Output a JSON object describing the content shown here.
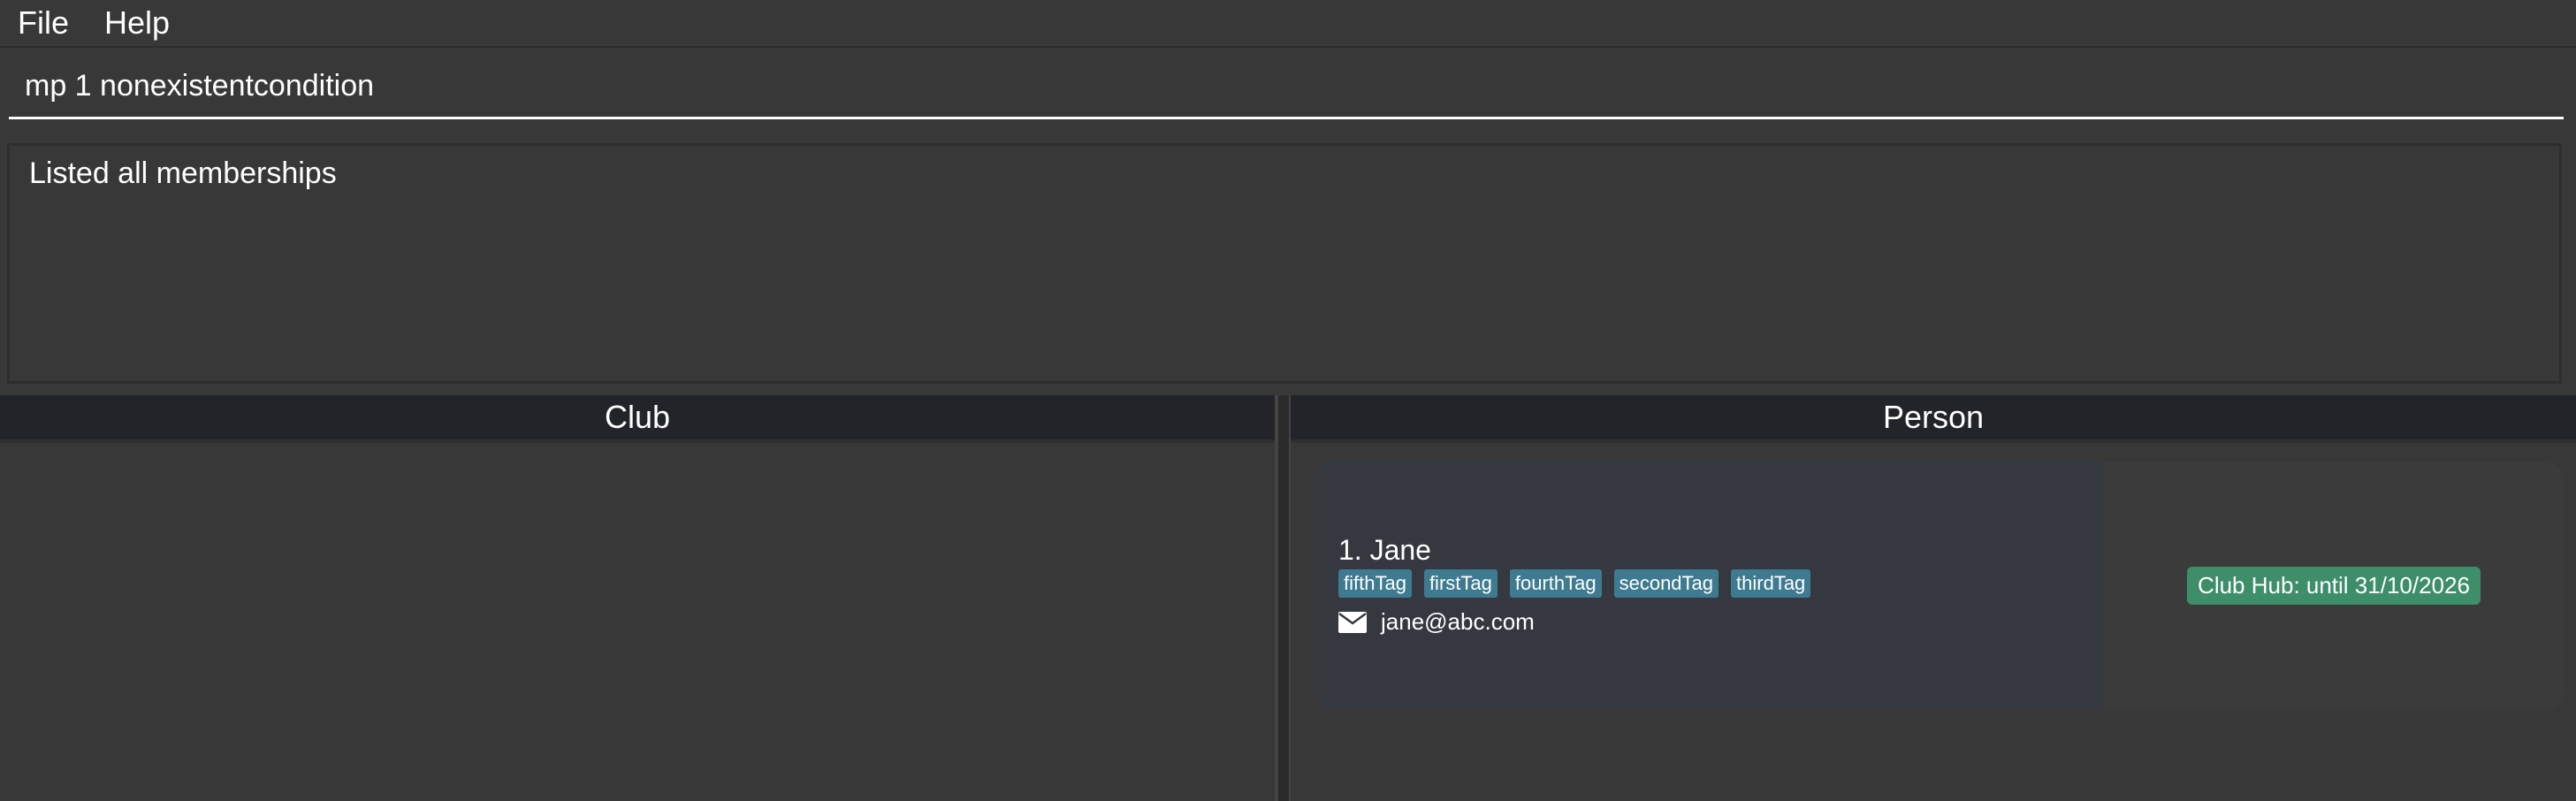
{
  "menu": {
    "file_label": "File",
    "help_label": "Help"
  },
  "command": {
    "value": "mp 1 nonexistentcondition"
  },
  "result": {
    "message": "Listed all memberships"
  },
  "panels": {
    "club_header": "Club",
    "person_header": "Person"
  },
  "persons": [
    {
      "index_name": "1. Jane",
      "tags": [
        "fifthTag",
        "firstTag",
        "fourthTag",
        "secondTag",
        "thirdTag"
      ],
      "email": "jane@abc.com",
      "email_icon": "envelope-icon",
      "membership": "Club Hub: until 31/10/2026"
    }
  ],
  "colors": {
    "background": "#383838",
    "header_bg": "#232429",
    "tag_bg": "#3e7b91",
    "membership_bg": "#3e8e6a",
    "card_bg": "#35383f"
  }
}
